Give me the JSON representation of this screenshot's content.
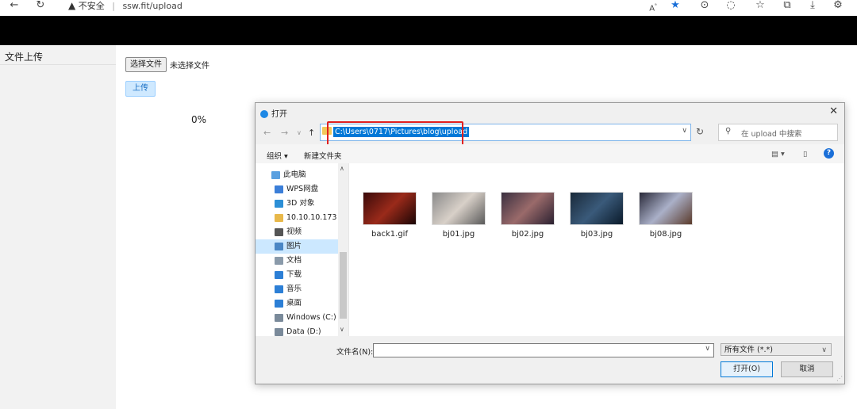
{
  "browser": {
    "security_text": "不安全",
    "url": "ssw.fit/upload",
    "icons": [
      "back-icon",
      "refresh-icon",
      "read-aloud-icon",
      "favorite-star-icon",
      "extension-icon",
      "copilot-icon",
      "favorites-icon",
      "collections-icon",
      "download-icon",
      "settings-icon"
    ]
  },
  "sidebar": {
    "items": [
      {
        "label": "文件上传"
      }
    ]
  },
  "main": {
    "choose_button": "选择文件",
    "no_file_text": "未选择文件",
    "upload_button": "上传",
    "progress_text": "0%"
  },
  "dialog": {
    "title": "打开",
    "address": "C:\\Users\\0717\\Pictures\\blog\\upload",
    "search_placeholder": "在 upload 中搜索",
    "toolbar": {
      "organize": "组织 ▾",
      "new_folder": "新建文件夹",
      "help": "?"
    },
    "nav_items": [
      {
        "label": "此电脑",
        "icon": "this-pc-icon",
        "color": "#5aa0e0"
      },
      {
        "label": "WPS网盘",
        "icon": "cloud-icon",
        "color": "#3b7ed8"
      },
      {
        "label": "3D 对象",
        "icon": "3d-objects-icon",
        "color": "#2c8fd6"
      },
      {
        "label": "10.10.10.173",
        "icon": "network-drive-icon",
        "color": "#e8b84a"
      },
      {
        "label": "视频",
        "icon": "videos-icon",
        "color": "#555555"
      },
      {
        "label": "图片",
        "icon": "pictures-icon",
        "color": "#4a86c5",
        "selected": true
      },
      {
        "label": "文档",
        "icon": "documents-icon",
        "color": "#8a9aaa"
      },
      {
        "label": "下载",
        "icon": "downloads-icon",
        "color": "#2c7fd6"
      },
      {
        "label": "音乐",
        "icon": "music-icon",
        "color": "#2c7fd6"
      },
      {
        "label": "桌面",
        "icon": "desktop-icon",
        "color": "#2c7fd6"
      },
      {
        "label": "Windows (C:)",
        "icon": "drive-c-icon",
        "color": "#7a8a9a"
      },
      {
        "label": "Data (D:)",
        "icon": "drive-d-icon",
        "color": "#7a8a9a"
      }
    ],
    "files": [
      {
        "name": "back1.gif",
        "thumb": "linear-gradient(135deg,#3a0a0a,#9a2a1a 50%,#1a0505)"
      },
      {
        "name": "bj01.jpg",
        "thumb": "linear-gradient(135deg,#8a8a8a,#d8d0c8 50%,#5a5a5a)"
      },
      {
        "name": "bj02.jpg",
        "thumb": "linear-gradient(135deg,#3a3040,#9a6a6a 50%,#2a2030)"
      },
      {
        "name": "bj03.jpg",
        "thumb": "linear-gradient(135deg,#1a2a3a,#3a5a7a 50%,#0a1a2a)"
      },
      {
        "name": "bj08.jpg",
        "thumb": "linear-gradient(135deg,#2a2a3a,#aab0c8 50%,#5a3a2a)"
      }
    ],
    "filename_label": "文件名(N):",
    "filename_value": "",
    "filetype": "所有文件 (*.*)",
    "open_button": "打开(O)",
    "cancel_button": "取消"
  }
}
